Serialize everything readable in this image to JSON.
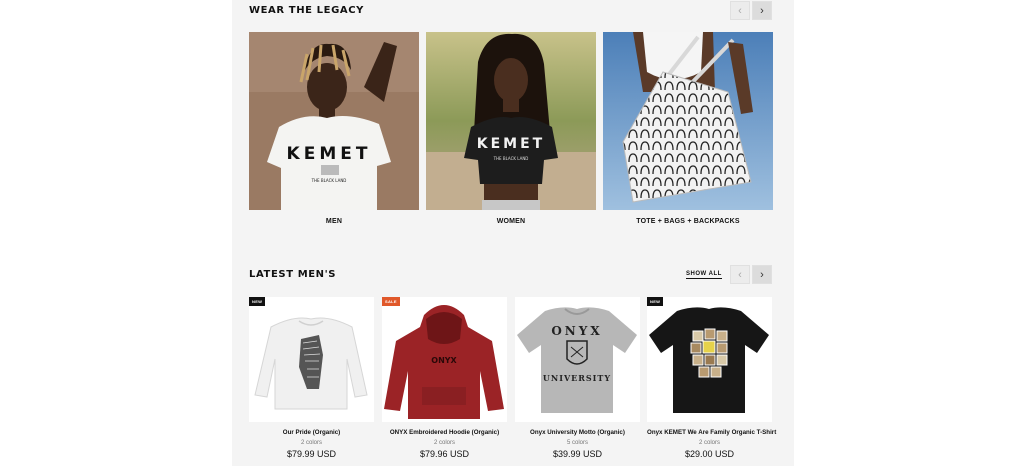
{
  "legacy": {
    "title": "WEAR THE LEGACY",
    "categories": [
      {
        "label": "MEN"
      },
      {
        "label": "WOMEN"
      },
      {
        "label": "TOTE + BAGS + BACKPACKS"
      }
    ],
    "print_text": "KEMET",
    "print_sub": "THE BLACK LAND"
  },
  "latest": {
    "title": "LATEST MEN'S",
    "show_all": "SHOW ALL",
    "products": [
      {
        "name": "Our Pride (Organic)",
        "colors": "2 colors",
        "price": "$79.99 USD",
        "badge": "NEW",
        "badge_color": "#111111"
      },
      {
        "name": "ONYX Embroidered Hoodie (Organic)",
        "colors": "2 colors",
        "price": "$79.96 USD",
        "badge": "SALE",
        "badge_color": "#e0582a"
      },
      {
        "name": "Onyx University Motto (Organic)",
        "colors": "5 colors",
        "price": "$39.99 USD",
        "badge": "",
        "badge_color": ""
      },
      {
        "name": "Onyx KEMET We Are Family Organic T-Shirt",
        "colors": "2 colors",
        "price": "$29.00 USD",
        "badge": "NEW",
        "badge_color": "#111111"
      }
    ],
    "hoodie_print": "ONYX",
    "tee_print_top": "ONYX",
    "tee_print_bottom": "UNIVERSITY"
  }
}
